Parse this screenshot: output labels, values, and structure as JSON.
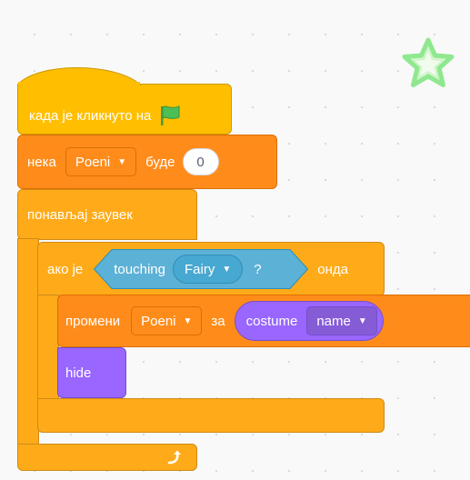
{
  "script": {
    "when_flag_clicked": {
      "label": "када је кликнуто на"
    },
    "set_variable": {
      "label_set": "нека",
      "variable": "Poeni",
      "label_to": "буде",
      "value": "0"
    },
    "forever": {
      "label": "понављај заувек"
    },
    "if_then": {
      "label_if": "ако је",
      "label_then": "онда",
      "condition": {
        "label": "touching",
        "target": "Fairy",
        "question": "?"
      }
    },
    "change_variable": {
      "label_change": "промени",
      "variable": "Poeni",
      "label_by": "за",
      "reporter": {
        "label": "costume",
        "field": "name"
      }
    },
    "hide": {
      "label": "hide"
    }
  },
  "icons": {
    "flag": "green-flag-icon",
    "arrow": "dropdown-arrow-icon",
    "loop": "loop-arrow-icon",
    "star": "star-icon"
  },
  "colors": {
    "events": "#FFBF00",
    "variables": "#FF8C1A",
    "control": "#FFAB19",
    "looks": "#9966FF",
    "sensing": "#5CB1D6",
    "star": "#8FE88F"
  }
}
